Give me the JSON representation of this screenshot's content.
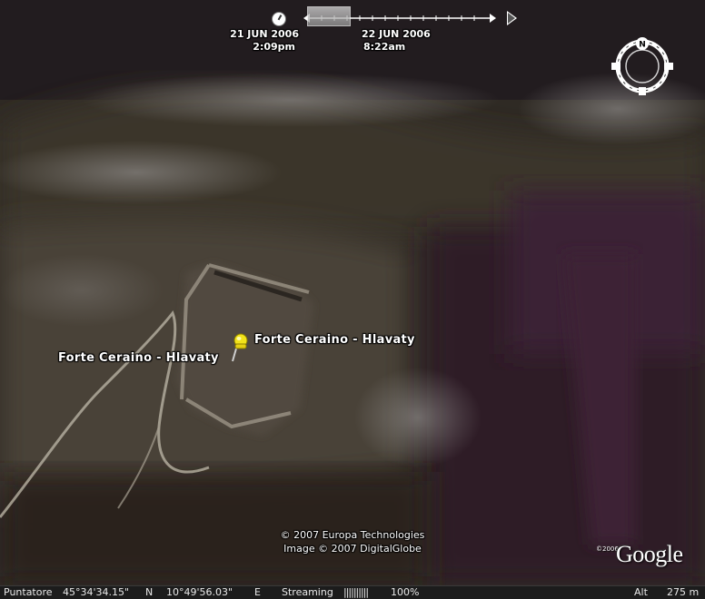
{
  "time_slider": {
    "start_date": "21 JUN 2006",
    "start_time": "2:09pm",
    "end_date": "22 JUN 2006",
    "end_time": "8:22am",
    "clock_icon": "clock-icon",
    "play_icon": "play-icon"
  },
  "navigation": {
    "compass_label": "N"
  },
  "placemark": {
    "label_primary": "Forte Ceraino - Hlavaty",
    "label_secondary": "Forte Ceraino - Hlavaty",
    "icon": "pushpin-icon",
    "color": "#f2e21a"
  },
  "credits": {
    "line1": "© 2007 Europa Technologies",
    "line2": "Image © 2007 DigitalGlobe",
    "logo_copyright": "©2006",
    "logo_text": "Google"
  },
  "status_bar": {
    "pointer_label": "Puntatore",
    "latitude": "45°34'34.15\"",
    "lat_hemisphere": "N",
    "longitude": "10°49'56.03\"",
    "lon_hemisphere": "E",
    "streaming_label": "Streaming",
    "streaming_bars": "||||||||||",
    "streaming_percent": "100%",
    "altitude_label": "Alt",
    "altitude_value": "275 m"
  }
}
